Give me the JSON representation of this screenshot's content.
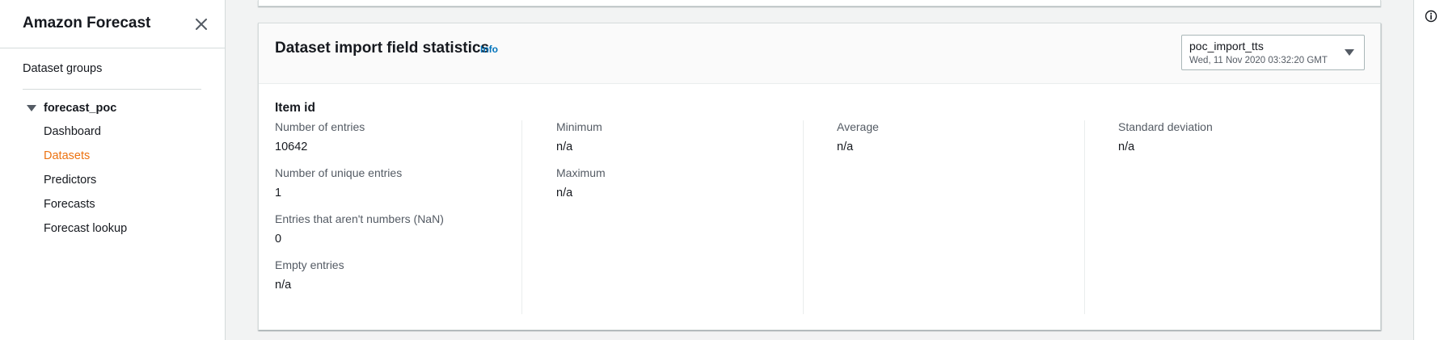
{
  "sidebar": {
    "title": "Amazon Forecast",
    "close_icon": "close-icon",
    "dataset_groups_label": "Dataset groups",
    "group": {
      "name": "forecast_poc",
      "expanded_icon": "caret-down-icon",
      "items": [
        {
          "label": "Dashboard",
          "active": false
        },
        {
          "label": "Datasets",
          "active": true
        },
        {
          "label": "Predictors",
          "active": false
        },
        {
          "label": "Forecasts",
          "active": false
        },
        {
          "label": "Forecast lookup",
          "active": false
        }
      ]
    }
  },
  "card": {
    "title": "Dataset import field statistics",
    "info_label": "Info",
    "import_select": {
      "value": "poc_import_tts",
      "subtitle": "Wed, 11 Nov 2020 03:32:20 GMT"
    },
    "field_name": "Item id",
    "columns": [
      [
        {
          "label": "Number of entries",
          "value": "10642"
        },
        {
          "label": "Number of unique entries",
          "value": "1"
        },
        {
          "label": "Entries that aren't numbers (NaN)",
          "value": "0"
        },
        {
          "label": "Empty entries",
          "value": "n/a"
        }
      ],
      [
        {
          "label": "Minimum",
          "value": "n/a"
        },
        {
          "label": "Maximum",
          "value": "n/a"
        }
      ],
      [
        {
          "label": "Average",
          "value": "n/a"
        }
      ],
      [
        {
          "label": "Standard deviation",
          "value": "n/a"
        }
      ]
    ]
  },
  "colors": {
    "active_nav": "#ec7211",
    "link": "#0073bb",
    "border": "#d5dbdb"
  },
  "right_panel": {
    "icon": "info-circle-icon"
  }
}
